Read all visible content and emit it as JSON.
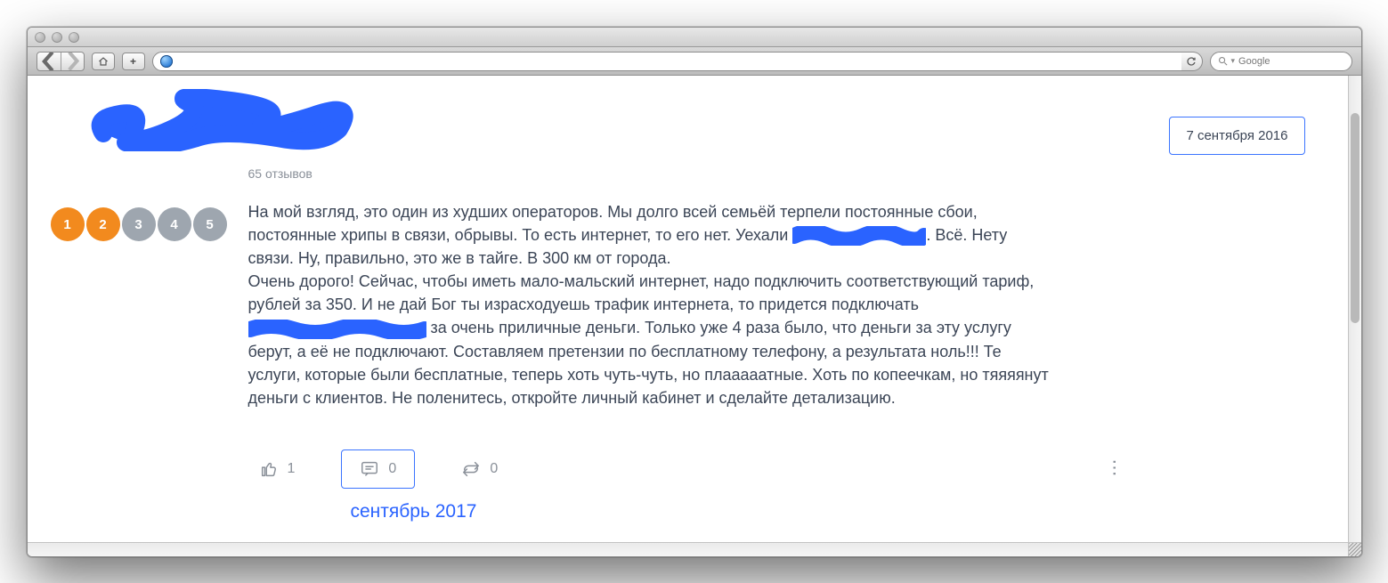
{
  "browser": {
    "search_placeholder": "Google"
  },
  "review": {
    "reviews_count": "65 отзывов",
    "date": "7 сентября 2016",
    "rating": {
      "value": 2,
      "max": 5
    },
    "text_parts": {
      "p1a": "На мой взгляд, это один из худших операторов. Мы долго всей семьёй терпели постоянные сбои, постоянные хрипы в связи, обрывы. То есть интернет, то его нет. Уехали ",
      "p1b": ". Всё. Нету связи. Ну, правильно, это же в тайге. В 300 км от города.",
      "p2a": "Очень дорого! Сейчас, чтобы иметь мало-мальский интернет, надо подключить соответствующий тариф, рублей за 350. И не дай Бог ты израсходуешь трафик интернета, то придется подключать ",
      "p2b": " за очень приличные деньги. Только уже 4 раза было, что деньги за эту услугу берут, а её не подключают. Составляем претензии по бесплатному телефону, а результата ноль!!! Те услуги, которые были бесплатные, теперь хоть чуть-чуть, но плааааатные. Хоть по копеечкам, но тяяяянут деньги с клиентов. Не поленитесь, откройте личный кабинет и сделайте детализацию."
    },
    "likes": "1",
    "comments": "0",
    "shares": "0",
    "footnote": "сентябрь 2017"
  }
}
